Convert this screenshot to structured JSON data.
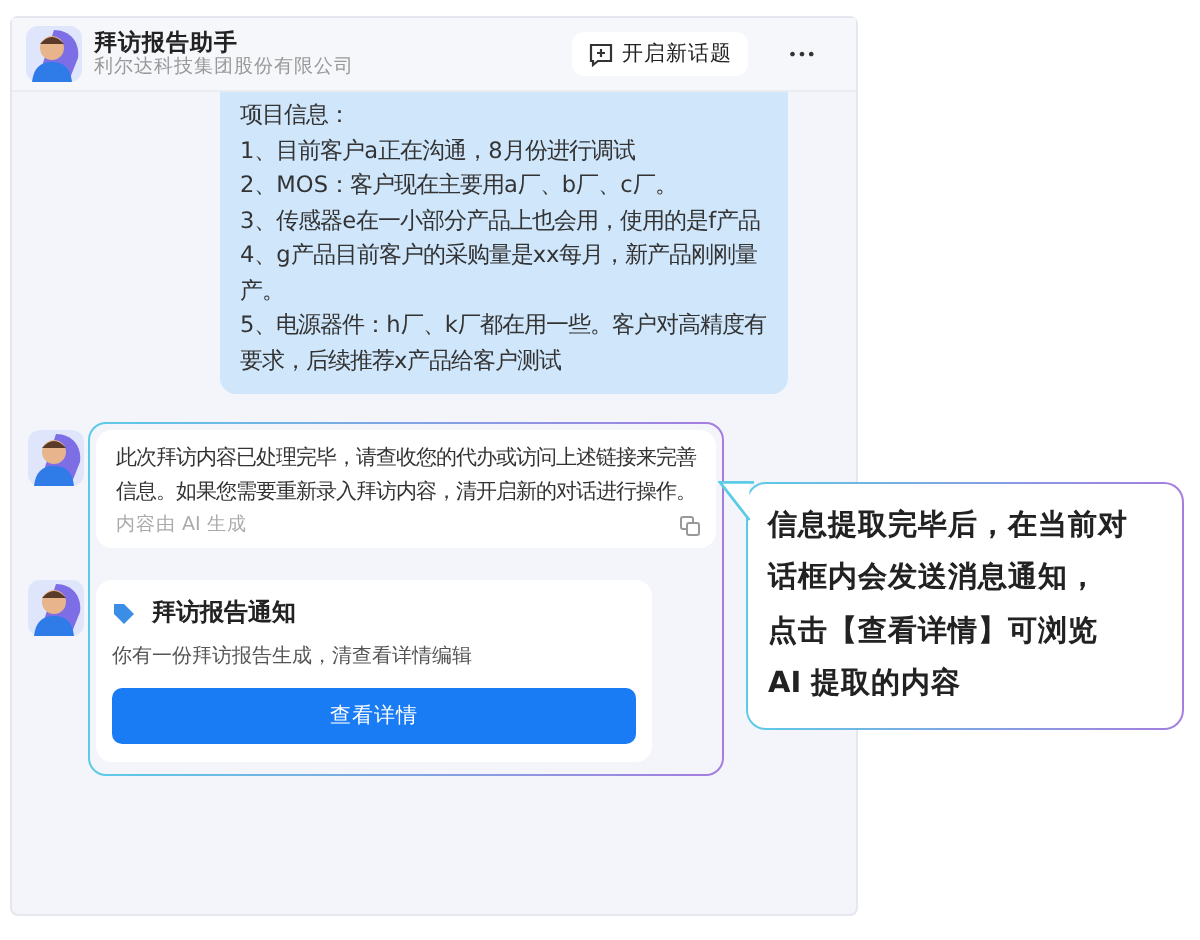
{
  "header": {
    "title": "拜访报告助手",
    "subtitle": "利尔达科技集团股份有限公司",
    "new_topic_button": "开启新话题",
    "more_button": "•••"
  },
  "user_message": {
    "lines": [
      "项目信息：",
      "1、目前客户a正在沟通，8月份进行调试",
      "2、MOS：客户现在主要用a厂、b厂、c厂。",
      "3、传感器e在一小部分产品上也会用，使用的是f产品",
      "4、g产品目前客户的采购量是xx每月，新产品刚刚量产。",
      "5、电源器件：h厂、k厂都在用一些。客户对高精度有要求，后续推荐x产品给客户测试"
    ]
  },
  "bot_message": {
    "text": "此次拜访内容已处理完毕，请查收您的代办或访问上述链接来完善信息。如果您需要重新录入拜访内容，清开启新的对话进行操作。",
    "note": "内容由 AI 生成"
  },
  "notice_card": {
    "title": "拜访报告通知",
    "text": "你有一份拜访报告生成，清查看详情编辑",
    "button": "查看详情"
  },
  "callout": {
    "lines": [
      "信息提取完毕后，在当前对",
      "话框内会发送消息通知，",
      "点击【查看详情】可浏览",
      "AI 提取的内容"
    ]
  }
}
